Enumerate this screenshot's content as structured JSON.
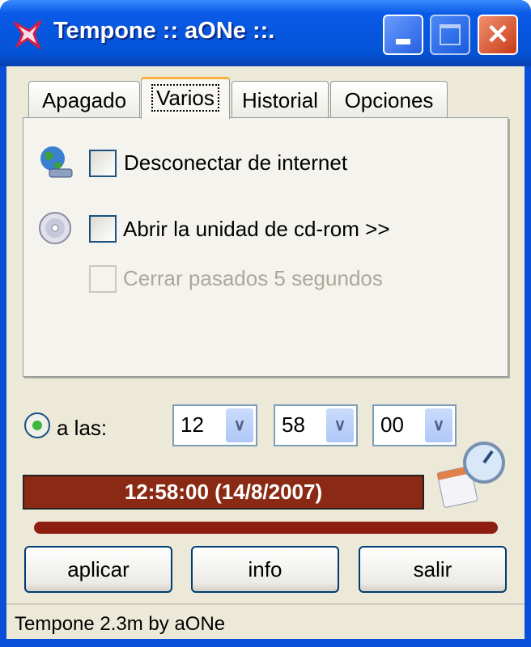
{
  "window": {
    "title": "Tempone :: aONe ::.",
    "controls": {
      "minimize": "minimize",
      "maximize": "maximize",
      "close": "close"
    }
  },
  "tabs": [
    {
      "label": "Apagado"
    },
    {
      "label": "Varios",
      "selected": true
    },
    {
      "label": "Historial"
    },
    {
      "label": "Opciones"
    }
  ],
  "panel": {
    "disconnect": {
      "label": "Desconectar de internet",
      "checked": false,
      "icon": "globe-network-icon"
    },
    "cdrom": {
      "label": "Abrir la unidad de cd-rom >>",
      "checked": false,
      "icon": "cd-icon"
    },
    "close_after": {
      "label": "Cerrar pasados 5 segundos",
      "checked": false,
      "enabled": false
    }
  },
  "schedule": {
    "radio_label": "a las:",
    "selected": true,
    "hour": "12",
    "minute": "58",
    "second": "00"
  },
  "time_display": "12:58:00 (14/8/2007)",
  "buttons": {
    "apply": "aplicar",
    "info": "info",
    "exit": "salir"
  },
  "status_bar": "Tempone 2.3m by aONe",
  "colors": {
    "time_box": "#8B2A14",
    "progress_bar": "#8E1E10",
    "titlebar": "#0453D6"
  }
}
